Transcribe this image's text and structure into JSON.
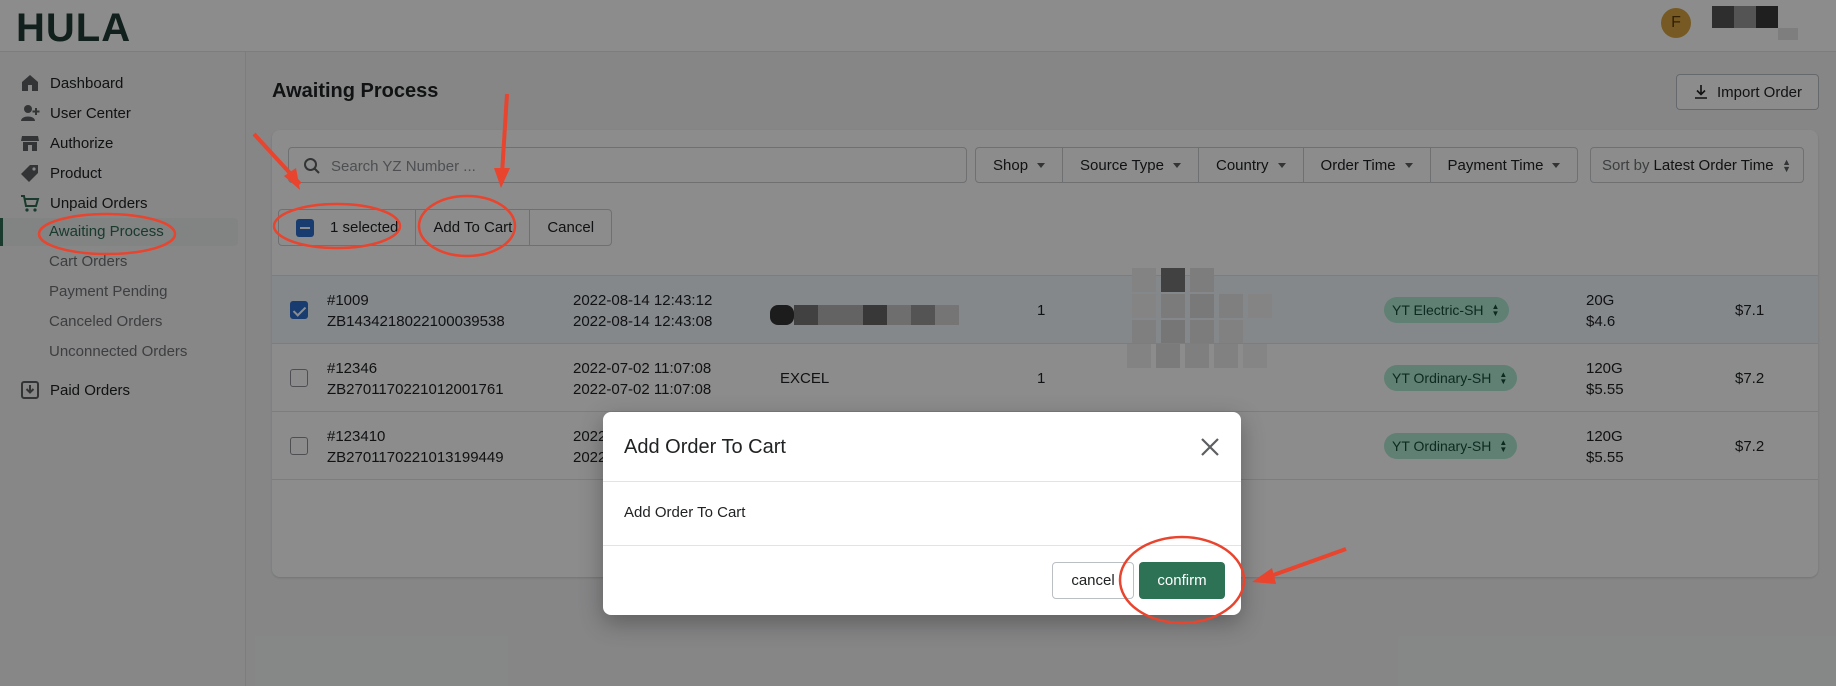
{
  "topbar": {
    "logo_text": "HULA",
    "avatar_initial": "F"
  },
  "sidebar": {
    "items": [
      {
        "label": "Dashboard",
        "icon": "home-icon"
      },
      {
        "label": "User Center",
        "icon": "user-add-icon"
      },
      {
        "label": "Authorize",
        "icon": "store-icon"
      },
      {
        "label": "Product",
        "icon": "tag-icon"
      },
      {
        "label": "Unpaid Orders",
        "icon": "cart-icon"
      },
      {
        "label": "Paid Orders",
        "icon": "download-icon"
      }
    ],
    "sub_items": [
      {
        "label": "Awaiting Process",
        "active": true
      },
      {
        "label": "Cart Orders"
      },
      {
        "label": "Payment Pending"
      },
      {
        "label": "Canceled Orders"
      },
      {
        "label": "Unconnected Orders"
      }
    ]
  },
  "main": {
    "title": "Awaiting Process",
    "import_label": "Import Order",
    "search_placeholder": "Search YZ Number ...",
    "filters": [
      "Shop",
      "Source Type",
      "Country",
      "Order Time",
      "Payment Time"
    ],
    "sort_prefix": "Sort by",
    "sort_value": "Latest Order Time",
    "bulk": {
      "selected_label": "1 selected",
      "add_label": "Add To Cart",
      "cancel_label": "Cancel"
    },
    "rows": [
      {
        "order_no": "#1009",
        "yz_no": "ZB1434218022100039538",
        "time1": "2022-08-14 12:43:12",
        "time2": "2022-08-14 12:43:08",
        "source": "",
        "qty": "1",
        "shipping": "YT Electric-SH",
        "weight": "20G",
        "ship_fee": "$4.6",
        "total": "$7.1",
        "checked": true
      },
      {
        "order_no": "#12346",
        "yz_no": "ZB2701170221012001761",
        "time1": "2022-07-02 11:07:08",
        "time2": "2022-07-02 11:07:08",
        "source": "EXCEL",
        "qty": "1",
        "shipping": "YT Ordinary-SH",
        "weight": "120G",
        "ship_fee": "$5.55",
        "total": "$7.2",
        "checked": false
      },
      {
        "order_no": "#123410",
        "yz_no": "ZB2701170221013199449",
        "time1": "2022",
        "time2": "2022",
        "source": "",
        "qty": "",
        "shipping": "YT Ordinary-SH",
        "weight": "120G",
        "ship_fee": "$5.55",
        "total": "$7.2",
        "checked": false
      }
    ]
  },
  "modal": {
    "title": "Add Order To Cart",
    "body": "Add Order To Cart",
    "cancel_label": "cancel",
    "confirm_label": "confirm"
  },
  "colors": {
    "brand_green": "#2e7256",
    "annotation_red": "#e8442e",
    "checkbox_blue": "#2c6ecb",
    "pill_green": "#aee9d1"
  }
}
